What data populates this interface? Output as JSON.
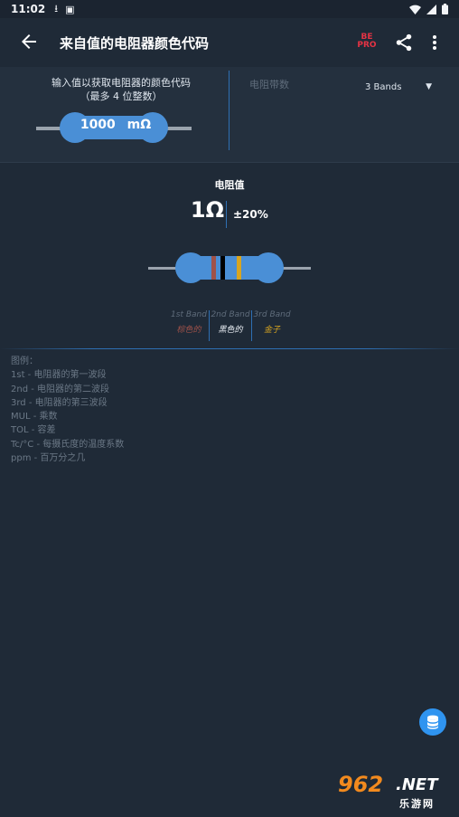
{
  "status": {
    "time": "11:02",
    "icons": [
      "download-icon",
      "image-icon",
      "wifi-icon",
      "signal-icon",
      "battery-icon"
    ]
  },
  "appbar": {
    "title": "来自值的电阻器颜色代码",
    "badge_line1": "BE",
    "badge_line2": "PRO"
  },
  "input_section": {
    "prompt_line1": "输入值以获取电阻器的颜色代码",
    "prompt_line2": "（最多 4 位整数）",
    "bands_label": "电阻带数",
    "bands_selected": "3 Bands",
    "input_value": "1000",
    "input_unit": "mΩ"
  },
  "result": {
    "label": "电阻值",
    "value": "1Ω",
    "tolerance": "±20%"
  },
  "bands": [
    {
      "name": "1st Band",
      "color_name": "棕色的",
      "color": "#a0524a"
    },
    {
      "name": "2nd Band",
      "color_name": "黑色的",
      "color": "#000000"
    },
    {
      "name": "3rd Band",
      "color_name": "金子",
      "color": "#d8a520"
    }
  ],
  "legend": {
    "title": "图例：",
    "items": [
      "1st - 电阻器的第一波段",
      "2nd - 电阻器的第二波段",
      "3rd - 电阻器的第三波段",
      "MUL - 乘数",
      "TOL - 容差",
      "Tc/°C - 每摄氏度的温度系数",
      "ppm - 百万分之几"
    ]
  },
  "colors": {
    "background": "#1f2a37",
    "accent": "#2e6fb3",
    "resistor_body": "#4a8fd6",
    "fab": "#2f94f0",
    "pro_badge": "#e53344"
  },
  "watermark": {
    "number": "962",
    "net": ".NET",
    "sub": "乐游网"
  }
}
